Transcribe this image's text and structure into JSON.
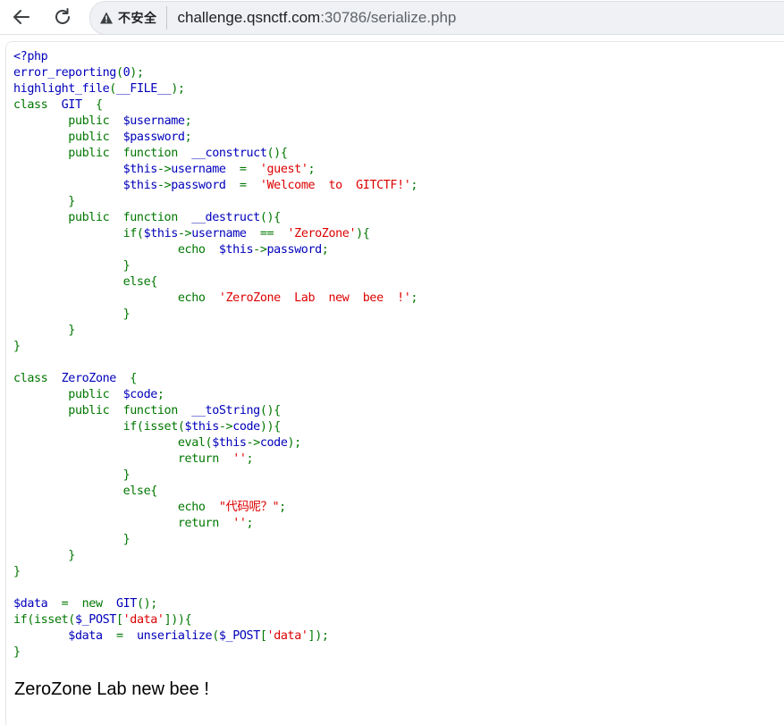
{
  "browser": {
    "security_label": "不安全",
    "url_host": "challenge.qsnctf.com",
    "url_rest": ":30786/serialize.php"
  },
  "colors": {
    "php_default": "#0000bb",
    "php_keyword": "#007700",
    "php_string": "#dd0000"
  },
  "code_lines": [
    [
      [
        "default",
        "<?php"
      ]
    ],
    [
      [
        "default",
        "error_reporting"
      ],
      [
        "keyword",
        "("
      ],
      [
        "default",
        "0"
      ],
      [
        "keyword",
        ");"
      ]
    ],
    [
      [
        "default",
        "highlight_file"
      ],
      [
        "keyword",
        "("
      ],
      [
        "default",
        "__FILE__"
      ],
      [
        "keyword",
        ");"
      ]
    ],
    [
      [
        "keyword",
        "class  "
      ],
      [
        "default",
        "GIT  "
      ],
      [
        "keyword",
        "{"
      ]
    ],
    [
      [
        "keyword",
        "        public  "
      ],
      [
        "default",
        "$username"
      ],
      [
        "keyword",
        ";"
      ]
    ],
    [
      [
        "keyword",
        "        public  "
      ],
      [
        "default",
        "$password"
      ],
      [
        "keyword",
        ";"
      ]
    ],
    [
      [
        "keyword",
        "        public  function  "
      ],
      [
        "default",
        "__construct"
      ],
      [
        "keyword",
        "(){"
      ]
    ],
    [
      [
        "keyword",
        "                "
      ],
      [
        "default",
        "$this"
      ],
      [
        "keyword",
        "->"
      ],
      [
        "default",
        "username  "
      ],
      [
        "keyword",
        "=  "
      ],
      [
        "string",
        "'guest'"
      ],
      [
        "keyword",
        ";"
      ]
    ],
    [
      [
        "keyword",
        "                "
      ],
      [
        "default",
        "$this"
      ],
      [
        "keyword",
        "->"
      ],
      [
        "default",
        "password  "
      ],
      [
        "keyword",
        "=  "
      ],
      [
        "string",
        "'Welcome  to  GITCTF!'"
      ],
      [
        "keyword",
        ";"
      ]
    ],
    [
      [
        "keyword",
        "        }"
      ]
    ],
    [
      [
        "keyword",
        "        public  function  "
      ],
      [
        "default",
        "__destruct"
      ],
      [
        "keyword",
        "(){"
      ]
    ],
    [
      [
        "keyword",
        "                if("
      ],
      [
        "default",
        "$this"
      ],
      [
        "keyword",
        "->"
      ],
      [
        "default",
        "username  "
      ],
      [
        "keyword",
        "==  "
      ],
      [
        "string",
        "'ZeroZone'"
      ],
      [
        "keyword",
        "){"
      ]
    ],
    [
      [
        "keyword",
        "                        echo  "
      ],
      [
        "default",
        "$this"
      ],
      [
        "keyword",
        "->"
      ],
      [
        "default",
        "password"
      ],
      [
        "keyword",
        ";"
      ]
    ],
    [
      [
        "keyword",
        "                }"
      ]
    ],
    [
      [
        "keyword",
        "                else{"
      ]
    ],
    [
      [
        "keyword",
        "                        echo  "
      ],
      [
        "string",
        "'ZeroZone  Lab  new  bee  !'"
      ],
      [
        "keyword",
        ";"
      ]
    ],
    [
      [
        "keyword",
        "                }"
      ]
    ],
    [
      [
        "keyword",
        "        }"
      ]
    ],
    [
      [
        "keyword",
        "}"
      ]
    ],
    [
      [
        "default",
        ""
      ]
    ],
    [
      [
        "keyword",
        "class  "
      ],
      [
        "default",
        "ZeroZone  "
      ],
      [
        "keyword",
        "{"
      ]
    ],
    [
      [
        "keyword",
        "        public  "
      ],
      [
        "default",
        "$code"
      ],
      [
        "keyword",
        ";"
      ]
    ],
    [
      [
        "keyword",
        "        public  function  "
      ],
      [
        "default",
        "__toString"
      ],
      [
        "keyword",
        "(){"
      ]
    ],
    [
      [
        "keyword",
        "                if(isset("
      ],
      [
        "default",
        "$this"
      ],
      [
        "keyword",
        "->"
      ],
      [
        "default",
        "code"
      ],
      [
        "keyword",
        ")){"
      ]
    ],
    [
      [
        "keyword",
        "                        eval("
      ],
      [
        "default",
        "$this"
      ],
      [
        "keyword",
        "->"
      ],
      [
        "default",
        "code"
      ],
      [
        "keyword",
        ");"
      ]
    ],
    [
      [
        "keyword",
        "                        return  "
      ],
      [
        "string",
        "''"
      ],
      [
        "keyword",
        ";"
      ]
    ],
    [
      [
        "keyword",
        "                }"
      ]
    ],
    [
      [
        "keyword",
        "                else{"
      ]
    ],
    [
      [
        "keyword",
        "                        echo  "
      ],
      [
        "string",
        "\"代码呢？\""
      ],
      [
        "keyword",
        ";"
      ]
    ],
    [
      [
        "keyword",
        "                        return  "
      ],
      [
        "string",
        "''"
      ],
      [
        "keyword",
        ";"
      ]
    ],
    [
      [
        "keyword",
        "                }"
      ]
    ],
    [
      [
        "keyword",
        "        }"
      ]
    ],
    [
      [
        "keyword",
        "}"
      ]
    ],
    [
      [
        "default",
        ""
      ]
    ],
    [
      [
        "default",
        "$data  "
      ],
      [
        "keyword",
        "=  new  "
      ],
      [
        "default",
        "GIT"
      ],
      [
        "keyword",
        "();"
      ]
    ],
    [
      [
        "keyword",
        "if(isset("
      ],
      [
        "default",
        "$_POST"
      ],
      [
        "keyword",
        "["
      ],
      [
        "string",
        "'data'"
      ],
      [
        "keyword",
        "])){"
      ]
    ],
    [
      [
        "default",
        "        $data  "
      ],
      [
        "keyword",
        "=  "
      ],
      [
        "default",
        "unserialize"
      ],
      [
        "keyword",
        "("
      ],
      [
        "default",
        "$_POST"
      ],
      [
        "keyword",
        "["
      ],
      [
        "string",
        "'data'"
      ],
      [
        "keyword",
        "]);"
      ]
    ],
    [
      [
        "keyword",
        "}"
      ]
    ]
  ],
  "page_output": "ZeroZone Lab new bee !"
}
